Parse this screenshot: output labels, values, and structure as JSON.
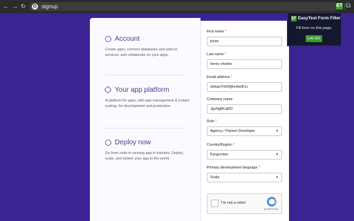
{
  "browser": {
    "back_icon": "←",
    "forward_icon": "→",
    "reload_icon": "↻",
    "g_label": "G",
    "url": "signup",
    "ext_label": "ET",
    "puzzle_icon": "⧉"
  },
  "features": [
    {
      "title": "Account",
      "description": "Create apps, connect databases and add-on services, and collaborate on your apps."
    },
    {
      "title": "Your app platform",
      "description": "A platform for apps, with app management & instant scaling, for development and production."
    },
    {
      "title": "Deploy now",
      "description": "Go from code to running app in minutes. Deploy, scale, and deliver your app to the world."
    }
  ],
  "form": {
    "first_name": {
      "label": "First name",
      "req": "*",
      "value": "jesse"
    },
    "last_name": {
      "label": "Last name",
      "req": "*",
      "value": "henry charles"
    },
    "email": {
      "label": "Email address",
      "req": "*",
      "value": "dzkwp7m59@ezlwdf.io"
    },
    "company": {
      "label": "Company name",
      "value": "JgcNgMcqRD"
    },
    "role": {
      "label": "Role",
      "req": "*",
      "value": "Agency / Partner Developer"
    },
    "country": {
      "label": "Country/Region",
      "req": "*",
      "value": "Kyrgyzstan"
    },
    "language": {
      "label": "Primary development language",
      "req": "*",
      "value": "Scala"
    },
    "select_chevron": "⬍"
  },
  "captcha": {
    "label": "I'm not a robot",
    "brand": "reCAPTCHA"
  },
  "popup": {
    "icon_label": "ET",
    "title": "EasyTest Form Filler",
    "message": "Fill form on this page.",
    "button": "Lets Go!"
  }
}
